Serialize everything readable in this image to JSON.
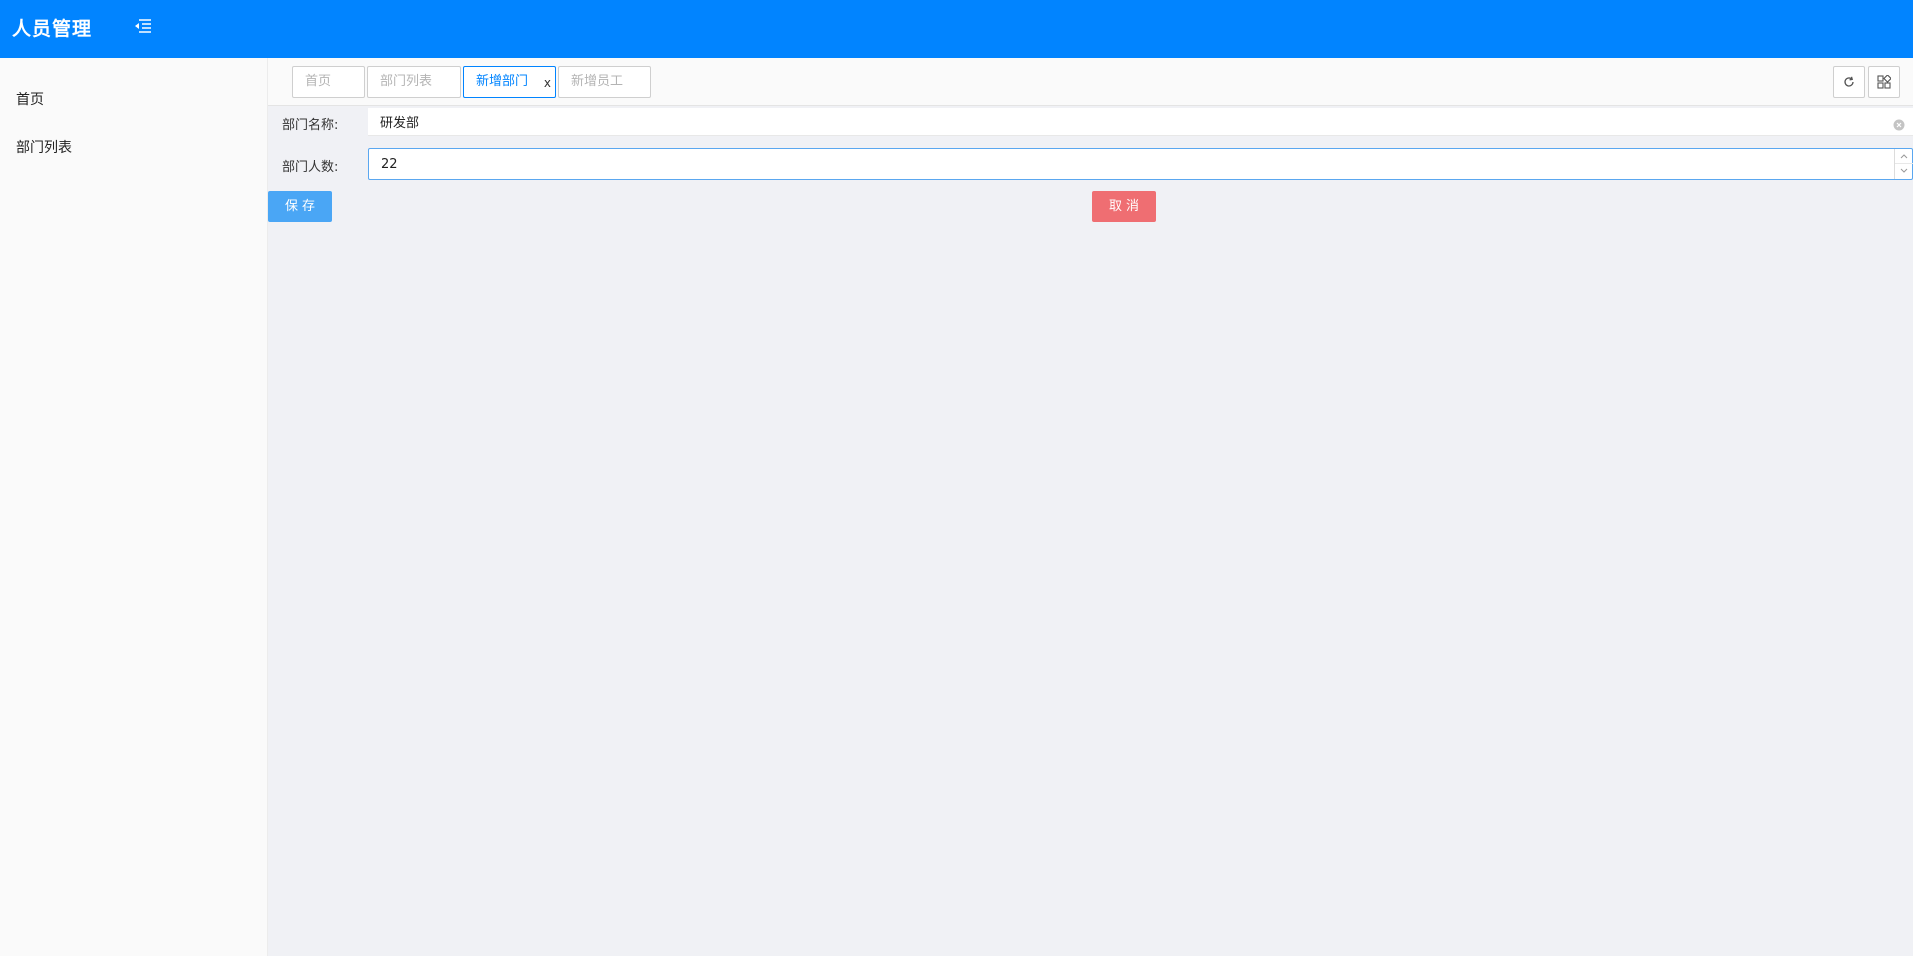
{
  "header": {
    "title": "人员管理",
    "menu_icon": "menu-fold-icon",
    "bg_color": "#0184ff"
  },
  "sidebar": {
    "items": [
      {
        "label": "首页"
      },
      {
        "label": "部门列表"
      }
    ]
  },
  "tabs": [
    {
      "label": "首页",
      "active": false
    },
    {
      "label": "部门列表",
      "active": false
    },
    {
      "label": "新增部门",
      "active": true,
      "close": "x"
    },
    {
      "label": "新增员工",
      "active": false
    }
  ],
  "toolbar": {
    "refresh_icon": "refresh-icon",
    "grid_icon": "grid-icon"
  },
  "form": {
    "name_label": "部门名称:",
    "name_value": "研发部",
    "count_label": "部门人数:",
    "count_value": "22"
  },
  "buttons": {
    "save": "保存",
    "cancel": "取消",
    "save_color": "#4aa6f5",
    "cancel_color": "#ef6e72"
  }
}
